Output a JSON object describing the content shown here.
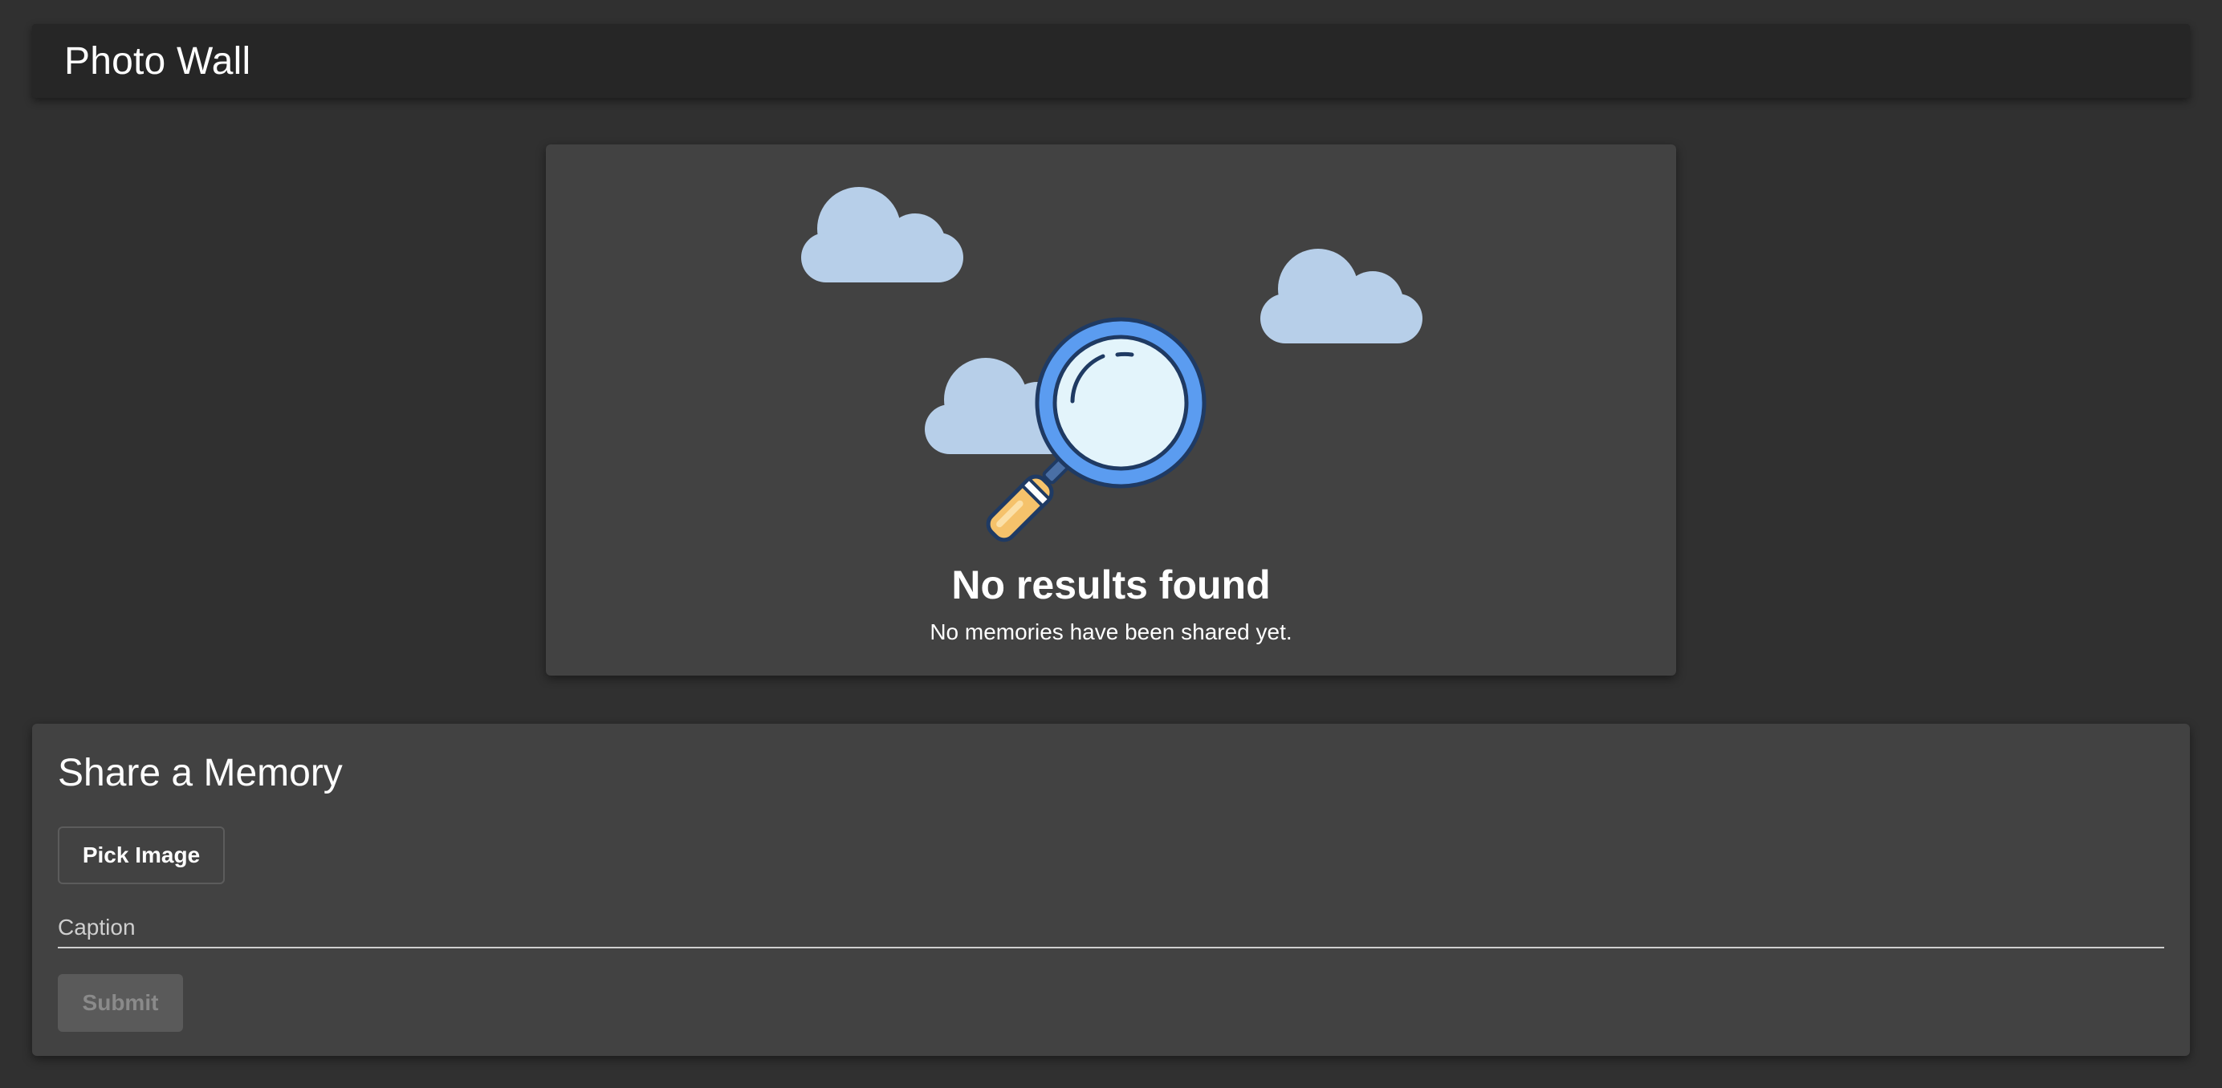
{
  "app_bar": {
    "title": "Photo Wall"
  },
  "empty_state": {
    "title": "No results found",
    "subtitle": "No memories have been shared yet.",
    "illustration_icon": "magnifying-glass-clouds",
    "colors": {
      "cloud": "#b7cfe9",
      "lens_ring": "#5b9cf0",
      "lens_glass": "#e3f4fb",
      "outline": "#1f3a63",
      "handle": "#f5c26b"
    }
  },
  "share_form": {
    "title": "Share a Memory",
    "pick_image_label": "Pick Image",
    "caption_placeholder": "Caption",
    "caption_value": "",
    "submit_label": "Submit",
    "submit_enabled": false
  },
  "theme": {
    "background": "#303030",
    "app_bar": "#262626",
    "card": "#424242"
  }
}
